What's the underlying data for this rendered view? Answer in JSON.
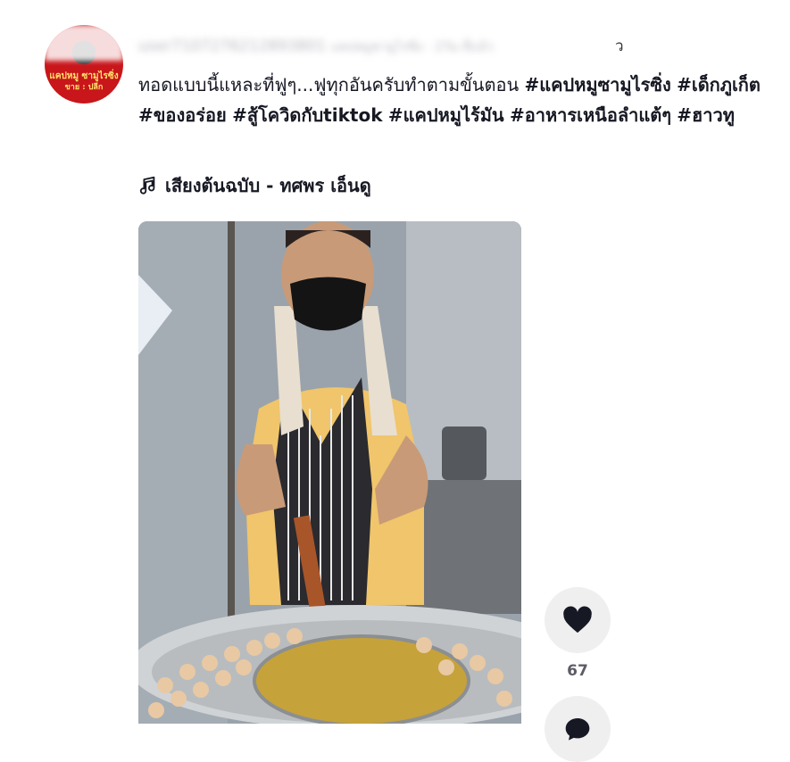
{
  "post": {
    "author_blurred": "user7107276212893801",
    "author_suffix_blurred": "แคปหมูซามูไรซิ่ง · 2วัน ที่แล้ว",
    "author_tail": "ว",
    "caption_text": "ทอดแบบนี้แหละที่ฟูๆ...ฟูทุกอันครับทำตามขั้นตอน",
    "hashtags": [
      "#แคปหมูซามูไรซิ่ง",
      "#เด็กภูเก็ต",
      "#ของอร่อย",
      "#สู้โควิดกับtiktok",
      "#แคปหมูไร้มัน",
      "#อาหารเหนือลำแต้ๆ",
      "#ฮาวทู"
    ],
    "music_label": "เสียงต้นฉบับ - ทศพร เอ็นดู"
  },
  "avatar": {
    "text_line1": "แคปหมู ซามูไรซิ่ง",
    "text_line2": "ขาย : ปลีก"
  },
  "actions": {
    "like_count": "67",
    "like_icon": "heart-icon",
    "comment_icon": "comment-icon"
  },
  "colors": {
    "text": "#161823",
    "action_bg": "#efeff0",
    "count": "#5c5c66",
    "avatar_red": "#c8161b"
  }
}
